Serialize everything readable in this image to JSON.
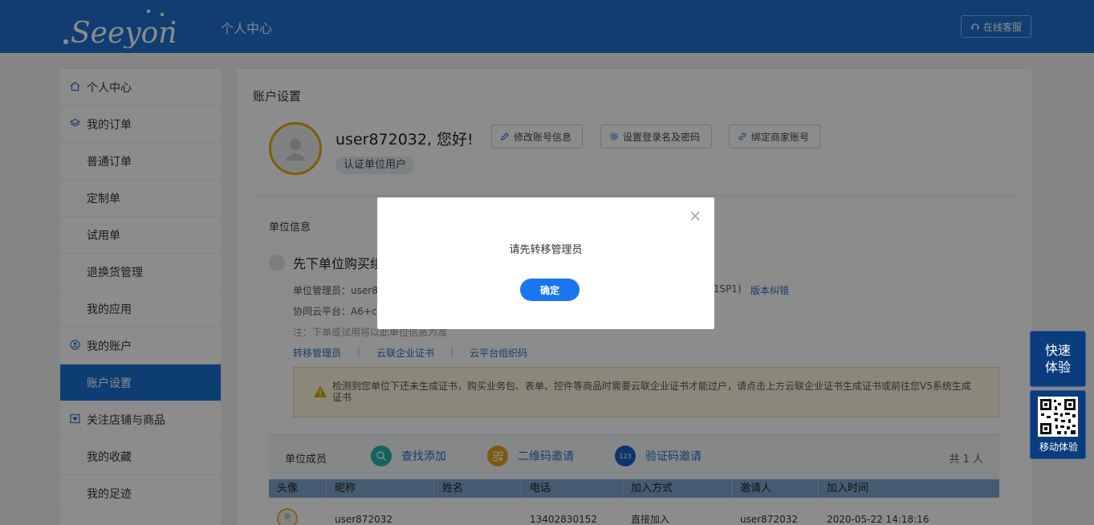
{
  "header": {
    "logo_text": ".Seeyon",
    "title": "个人中心",
    "service_label": "在线客服"
  },
  "sidebar": {
    "items": [
      {
        "label": "个人中心",
        "icon": "home-icon"
      },
      {
        "label": "我的订单",
        "icon": "layers-icon"
      },
      {
        "label": "普通订单"
      },
      {
        "label": "定制单"
      },
      {
        "label": "试用单"
      },
      {
        "label": "退换货管理"
      },
      {
        "label": "我的应用"
      },
      {
        "label": "我的账户",
        "icon": "account-icon"
      },
      {
        "label": "账户设置",
        "active": true
      },
      {
        "label": "关注店铺与商品",
        "icon": "heart-icon"
      },
      {
        "label": "我的收藏"
      },
      {
        "label": "我的足迹"
      }
    ]
  },
  "main": {
    "title": "账户设置",
    "greeting": "user872032, 您好!",
    "cert_tag": "认证单位用户",
    "buttons": {
      "edit_account": "修改账号信息",
      "login_password": "设置登录名及密码",
      "bind_merchant": "绑定商家账号"
    },
    "unit_info_label": "单位信息",
    "unit_name": "先下单位购买续",
    "admin_line": "单位管理员：user87",
    "version_suffix": ".1SP1)",
    "version_link": "版本纠错",
    "platform_line": "协同云平台：A6+cl",
    "note_line": "注：下单或试用将以此单位信息为准",
    "links": {
      "transfer_admin": "转移管理员",
      "cloud_cert": "云联企业证书",
      "org_code": "云平台组织码"
    },
    "warning": "检测到您单位下还未生成证书，购买业务包、表单、控件等商品时需要云联企业证书才能过户，请点击上方云联企业证书生成证书或前往您V5系统生成证书"
  },
  "members": {
    "title": "单位成员",
    "find_add": "查找添加",
    "qr_invite": "二维码邀请",
    "code_invite": "验证码邀请",
    "code_icon_text": "123",
    "count": "共 1 人",
    "columns": [
      "头像",
      "昵称",
      "姓名",
      "电话",
      "加入方式",
      "邀请人",
      "加入时间"
    ],
    "rows": [
      {
        "nickname": "user872032",
        "name": "",
        "phone": "13402830152",
        "join_method": "直接加入",
        "inviter": "user872032",
        "join_time": "2020-05-22 14:18:16"
      }
    ]
  },
  "modal": {
    "message": "请先转移管理员",
    "ok_label": "确定"
  },
  "floating": {
    "quick_label_1": "快速",
    "quick_label_2": "体验",
    "mobile_label": "移动体验"
  },
  "colors": {
    "header_bg": "#1f6fd0",
    "accent": "#1a76f0",
    "active_sidebar": "#1a6fd1",
    "avatar_ring": "#e5a80f"
  }
}
